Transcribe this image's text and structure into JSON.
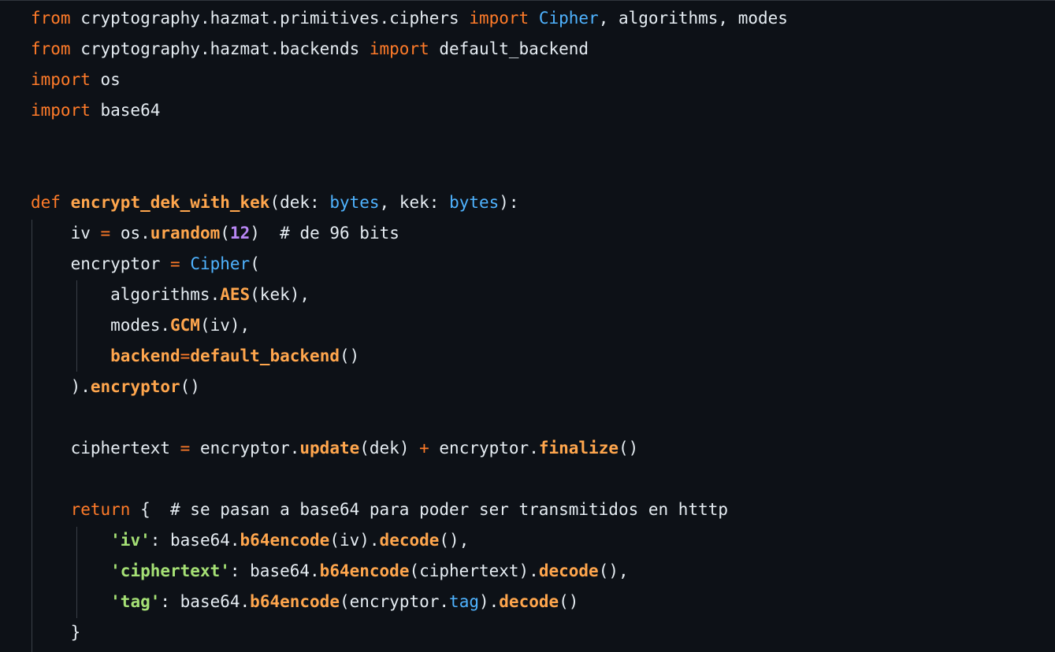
{
  "colors": {
    "background": "#0d1117",
    "keyword": "#ff7b29",
    "class": "#4fb3ff",
    "function": "#ffa64d",
    "number": "#b987f5",
    "string": "#a5e075",
    "text": "#e6edf3",
    "indent_guide": "#3a4048"
  },
  "code": {
    "lines": [
      [
        {
          "t": "kw",
          "v": "from"
        },
        {
          "t": "txt",
          "v": " cryptography.hazmat.primitives.ciphers "
        },
        {
          "t": "kw",
          "v": "import"
        },
        {
          "t": "txt",
          "v": " "
        },
        {
          "t": "cls",
          "v": "Cipher"
        },
        {
          "t": "txt",
          "v": ", algorithms, modes"
        }
      ],
      [
        {
          "t": "kw",
          "v": "from"
        },
        {
          "t": "txt",
          "v": " cryptography.hazmat.backends "
        },
        {
          "t": "kw",
          "v": "import"
        },
        {
          "t": "txt",
          "v": " default_backend"
        }
      ],
      [
        {
          "t": "kw",
          "v": "import"
        },
        {
          "t": "txt",
          "v": " os"
        }
      ],
      [
        {
          "t": "kw",
          "v": "import"
        },
        {
          "t": "txt",
          "v": " base64"
        }
      ],
      [],
      [],
      [
        {
          "t": "kw",
          "v": "def"
        },
        {
          "t": "txt",
          "v": " "
        },
        {
          "t": "fn",
          "v": "encrypt_dek_with_kek"
        },
        {
          "t": "txt",
          "v": "(dek: "
        },
        {
          "t": "cls",
          "v": "bytes"
        },
        {
          "t": "txt",
          "v": ", kek: "
        },
        {
          "t": "cls",
          "v": "bytes"
        },
        {
          "t": "txt",
          "v": "):"
        }
      ],
      [
        {
          "t": "txt",
          "v": "    iv "
        },
        {
          "t": "kw",
          "v": "="
        },
        {
          "t": "txt",
          "v": " os."
        },
        {
          "t": "fn",
          "v": "urandom"
        },
        {
          "t": "txt",
          "v": "("
        },
        {
          "t": "num",
          "v": "12"
        },
        {
          "t": "txt",
          "v": ")  "
        },
        {
          "t": "com",
          "v": "# de 96 bits"
        }
      ],
      [
        {
          "t": "txt",
          "v": "    encryptor "
        },
        {
          "t": "kw",
          "v": "="
        },
        {
          "t": "txt",
          "v": " "
        },
        {
          "t": "cls",
          "v": "Cipher"
        },
        {
          "t": "txt",
          "v": "("
        }
      ],
      [
        {
          "t": "txt",
          "v": "        algorithms."
        },
        {
          "t": "fn",
          "v": "AES"
        },
        {
          "t": "txt",
          "v": "(kek),"
        }
      ],
      [
        {
          "t": "txt",
          "v": "        modes."
        },
        {
          "t": "fn",
          "v": "GCM"
        },
        {
          "t": "txt",
          "v": "(iv),"
        }
      ],
      [
        {
          "t": "txt",
          "v": "        "
        },
        {
          "t": "fn",
          "v": "backend"
        },
        {
          "t": "kw",
          "v": "="
        },
        {
          "t": "fn",
          "v": "default_backend"
        },
        {
          "t": "txt",
          "v": "()"
        }
      ],
      [
        {
          "t": "txt",
          "v": "    )."
        },
        {
          "t": "fn",
          "v": "encryptor"
        },
        {
          "t": "txt",
          "v": "()"
        }
      ],
      [],
      [
        {
          "t": "txt",
          "v": "    ciphertext "
        },
        {
          "t": "kw",
          "v": "="
        },
        {
          "t": "txt",
          "v": " encryptor."
        },
        {
          "t": "fn",
          "v": "update"
        },
        {
          "t": "txt",
          "v": "(dek) "
        },
        {
          "t": "kw",
          "v": "+"
        },
        {
          "t": "txt",
          "v": " encryptor."
        },
        {
          "t": "fn",
          "v": "finalize"
        },
        {
          "t": "txt",
          "v": "()"
        }
      ],
      [],
      [
        {
          "t": "txt",
          "v": "    "
        },
        {
          "t": "kw",
          "v": "return"
        },
        {
          "t": "txt",
          "v": " {  "
        },
        {
          "t": "com",
          "v": "# se pasan a base64 para poder ser transmitidos en htttp"
        }
      ],
      [
        {
          "t": "txt",
          "v": "        "
        },
        {
          "t": "str",
          "v": "'iv'"
        },
        {
          "t": "txt",
          "v": ": base64."
        },
        {
          "t": "fn",
          "v": "b64encode"
        },
        {
          "t": "txt",
          "v": "(iv)."
        },
        {
          "t": "fn",
          "v": "decode"
        },
        {
          "t": "txt",
          "v": "(),"
        }
      ],
      [
        {
          "t": "txt",
          "v": "        "
        },
        {
          "t": "str",
          "v": "'ciphertext'"
        },
        {
          "t": "txt",
          "v": ": base64."
        },
        {
          "t": "fn",
          "v": "b64encode"
        },
        {
          "t": "txt",
          "v": "(ciphertext)."
        },
        {
          "t": "fn",
          "v": "decode"
        },
        {
          "t": "txt",
          "v": "(),"
        }
      ],
      [
        {
          "t": "txt",
          "v": "        "
        },
        {
          "t": "str",
          "v": "'tag'"
        },
        {
          "t": "txt",
          "v": ": base64."
        },
        {
          "t": "fn",
          "v": "b64encode"
        },
        {
          "t": "txt",
          "v": "(encryptor."
        },
        {
          "t": "attr",
          "v": "tag"
        },
        {
          "t": "txt",
          "v": ")."
        },
        {
          "t": "fn",
          "v": "decode"
        },
        {
          "t": "txt",
          "v": "()"
        }
      ],
      [
        {
          "t": "txt",
          "v": "    }"
        }
      ]
    ]
  }
}
